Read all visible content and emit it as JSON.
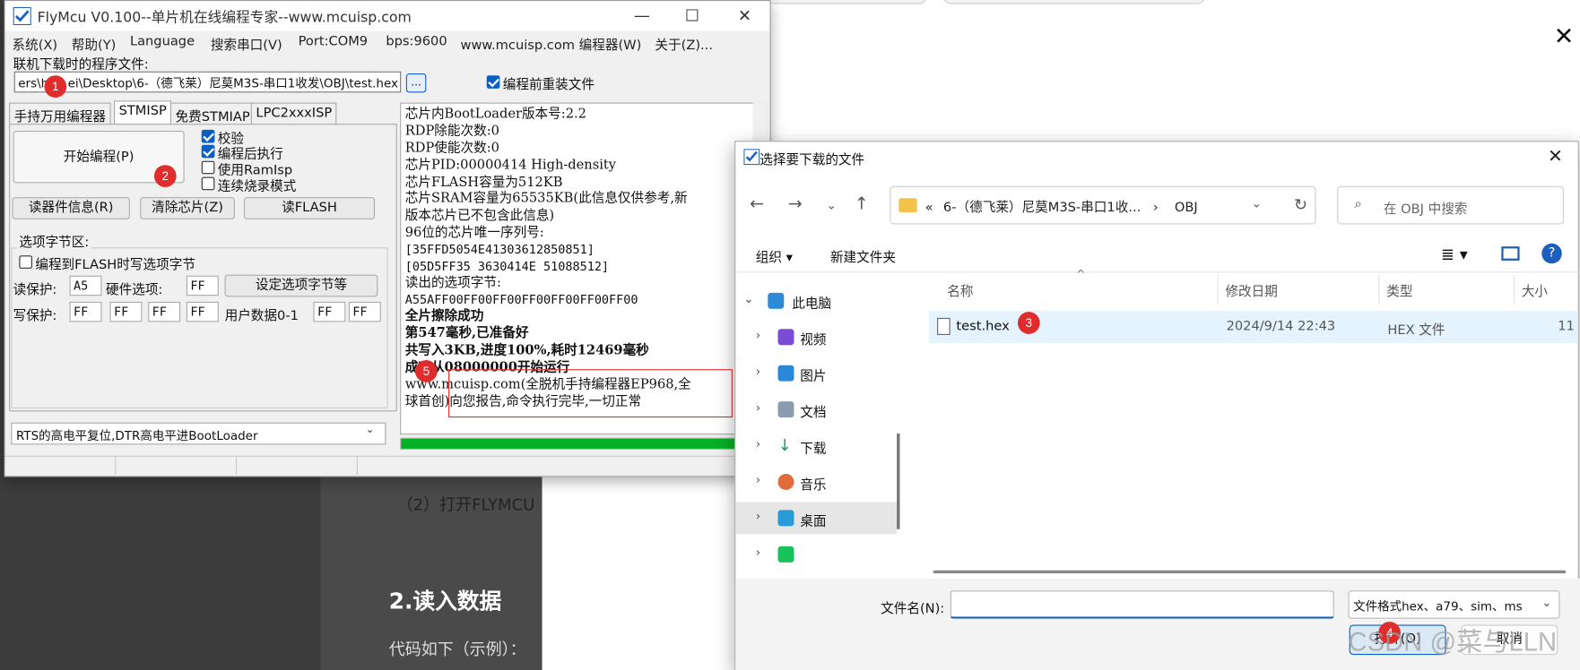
{
  "article": {
    "step_text": "（2）打开FLYMCU",
    "heading": "2.读入数据",
    "code_intro": "代码如下（示例）："
  },
  "flymcu": {
    "title": "FlyMcu V0.100--单片机在线编程专家--www.mcuisp.com",
    "menu": [
      "系统(X)",
      "帮助(Y)",
      "Language",
      "搜索串口(V)",
      "Port:COM9",
      "bps:9600",
      "www.mcuisp.com 编程器(W)",
      "关于(Z)..."
    ],
    "file_label": "联机下载时的程序文件:",
    "file_path": "ers\\hu...ei\\Desktop\\6-（德飞莱）尼莫M3S-串口1收发\\OBJ\\test.hex",
    "dots": "...",
    "reload_label": "编程前重装文件",
    "reload_checked": true,
    "tabs": [
      "手持万用编程器",
      "STMISP",
      "免费STMIAP",
      "LPC2xxxISP"
    ],
    "start_button": "开始编程(P)",
    "options": [
      {
        "label": "校验",
        "checked": true
      },
      {
        "label": "编程后执行",
        "checked": true
      },
      {
        "label": "使用RamIsp",
        "checked": false
      },
      {
        "label": "连续烧录模式",
        "checked": false
      }
    ],
    "read_info_button": "读器件信息(R)",
    "erase_button": "清除芯片(Z)",
    "read_flash_button": "读FLASH",
    "option_bytes_title": "选项字节区:",
    "write_option_label": "编程到FLASH时写选项字节",
    "read_protect_label": "读保护:",
    "read_protect_value": "A5",
    "hw_option_label": "硬件选项:",
    "hw_option_value": "FF",
    "set_option_button": "设定选项字节等",
    "write_protect_label": "写保护:",
    "write_protect_values": [
      "FF",
      "FF",
      "FF",
      "FF"
    ],
    "user_data_label": "用户数据0-1",
    "user_data_values": [
      "FF",
      "FF"
    ],
    "reset_mode": "RTS的高电平复位,DTR高电平进BootLoader",
    "log": [
      "芯片内BootLoader版本号:2.2",
      "RDP除能次数:0",
      "RDP使能次数:0",
      "芯片PID:00000414  High-density",
      "芯片FLASH容量为512KB",
      "芯片SRAM容量为65535KB(此信息仅供参考,新",
      "版本芯片已不包含此信息)",
      "96位的芯片唯一序列号:",
      "[35FFD5054E41303612850851]",
      "[05D5FF35 3630414E 51088512]",
      "读出的选项字节:",
      "A55AFF00FF00FF00FF00FF00FF00FF00",
      "全片擦除成功",
      "第547毫秒,已准备好",
      "共写入3KB,进度100%,耗时12469毫秒",
      "成功从08000000开始运行",
      "www.mcuisp.com(全脱机手持编程器EP968,全",
      "球首创)向您报告,命令执行完毕,一切正常"
    ],
    "progress": 1.0
  },
  "dialog": {
    "title": "选择要下载的文件",
    "breadcrumb": [
      "«",
      "6-（德飞莱）尼莫M3S-串口1收...",
      "›",
      "OBJ"
    ],
    "search_placeholder": "在 OBJ 中搜索",
    "organize": "组织 ▾",
    "new_folder": "新建文件夹",
    "nav": [
      "此电脑",
      "视频",
      "图片",
      "文档",
      "下载",
      "音乐",
      "桌面",
      ""
    ],
    "columns": [
      "名称",
      "修改日期",
      "类型",
      "大小"
    ],
    "file": {
      "name": "test.hex",
      "date": "2024/9/14 22:43",
      "type": "HEX 文件",
      "size": "11"
    },
    "filename_label": "文件名(N):",
    "filename_value": "",
    "filetype": "文件格式hex、a79、sim、ms",
    "open_button": "打开(O)",
    "cancel_button": "取消"
  },
  "badges": [
    "1",
    "2",
    "3",
    "4",
    "5"
  ],
  "watermark": "CSDN @菜与LLN",
  "colors": {
    "accent": "#0a5fc2",
    "badge": "#e02c2c",
    "progress": "#06b025"
  }
}
